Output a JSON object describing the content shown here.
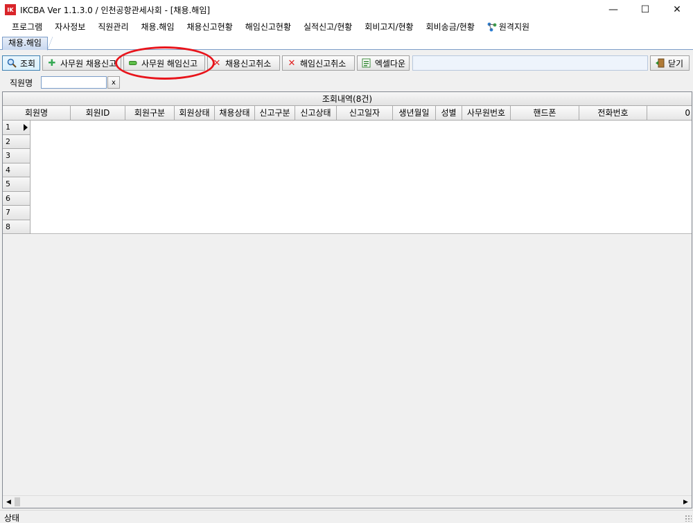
{
  "window": {
    "logo_text": "IK",
    "title": "IKCBA Ver 1.1.3.0 / 인천공항관세사회 - [채용.해임]",
    "minimize": "—",
    "maximize": "☐",
    "close": "✕"
  },
  "menu": [
    {
      "label": "프로그램"
    },
    {
      "label": "자사정보"
    },
    {
      "label": "직원관리"
    },
    {
      "label": "채용.해임"
    },
    {
      "label": "채용신고현황"
    },
    {
      "label": "해임신고현황"
    },
    {
      "label": "실적신고/현황"
    },
    {
      "label": "회비고지/현황"
    },
    {
      "label": "회비송금/현황"
    },
    {
      "label": "원격지원",
      "icon": "network-icon"
    }
  ],
  "tab": {
    "label": "채용.해임"
  },
  "toolbar": {
    "search_label": "조회",
    "hire_label": "사무원 채용신고",
    "dismiss_label": "사무원 해임신고",
    "cancel_hire_label": "채용신고취소",
    "cancel_dismiss_label": "해임신고취소",
    "excel_label": "엑셀다운",
    "close_label": "닫기",
    "accent_color": "#e8141b"
  },
  "filter": {
    "label": "직원명",
    "value": "",
    "clear": "x"
  },
  "grid": {
    "caption": "조회내역(8건)",
    "columns": [
      "회원명",
      "회원ID",
      "회원구분",
      "회원상태",
      "채용상태",
      "신고구분",
      "신고상태",
      "신고일자",
      "생년월일",
      "성별",
      "사무원번호",
      "핸드폰",
      "전화번호",
      "0"
    ],
    "rows": [
      "1",
      "2",
      "3",
      "4",
      "5",
      "6",
      "7",
      "8"
    ]
  },
  "status": {
    "label": "상태"
  }
}
